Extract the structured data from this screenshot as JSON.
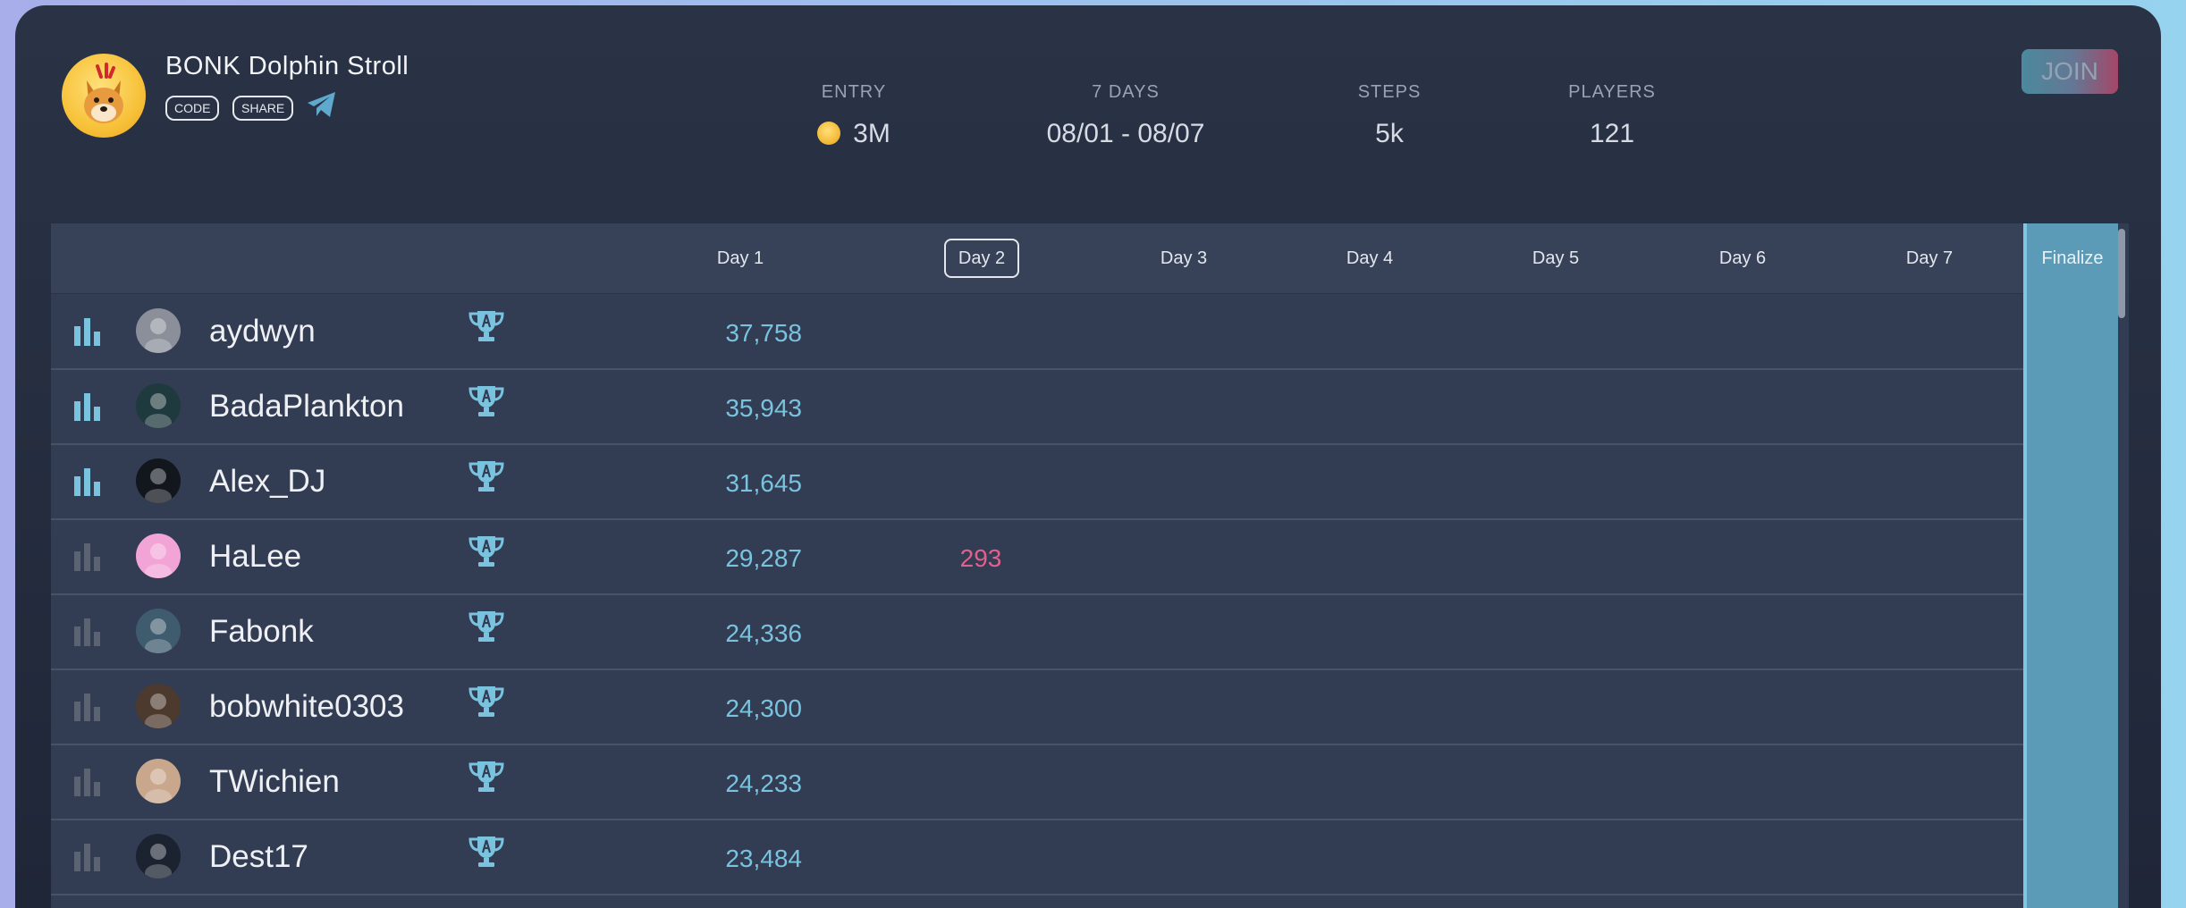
{
  "header": {
    "title": "BONK Dolphin Stroll",
    "code_label": "CODE",
    "share_label": "SHARE",
    "stats": [
      {
        "label": "ENTRY",
        "value": "3M"
      },
      {
        "label": "7 DAYS",
        "value": "08/01 - 08/07"
      },
      {
        "label": "STEPS",
        "value": "5k"
      },
      {
        "label": "PLAYERS",
        "value": "121"
      }
    ],
    "join_label": "JOIN"
  },
  "table": {
    "days": [
      "Day 1",
      "Day 2",
      "Day 3",
      "Day 4",
      "Day 5",
      "Day 6",
      "Day 7"
    ],
    "selected_day": "Day 2",
    "finalize_label": "Finalize",
    "rows": [
      {
        "name": "aydwyn",
        "day1": "37,758",
        "day2": "",
        "active": true
      },
      {
        "name": "BadaPlankton",
        "day1": "35,943",
        "day2": "",
        "active": true
      },
      {
        "name": "Alex_DJ",
        "day1": "31,645",
        "day2": "",
        "active": true
      },
      {
        "name": "HaLee",
        "day1": "29,287",
        "day2": "293",
        "active": false
      },
      {
        "name": "Fabonk",
        "day1": "24,336",
        "day2": "",
        "active": false
      },
      {
        "name": "bobwhite0303",
        "day1": "24,300",
        "day2": "",
        "active": false
      },
      {
        "name": "TWichien",
        "day1": "24,233",
        "day2": "",
        "active": false
      },
      {
        "name": "Dest17",
        "day1": "23,484",
        "day2": "",
        "active": false
      }
    ]
  },
  "colors": {
    "accent": "#79c3df",
    "finalize": "#5b9bb7",
    "day2_value": "#e0608e",
    "bar_active": "#79c3df",
    "bar_inactive": "#5b6372"
  }
}
